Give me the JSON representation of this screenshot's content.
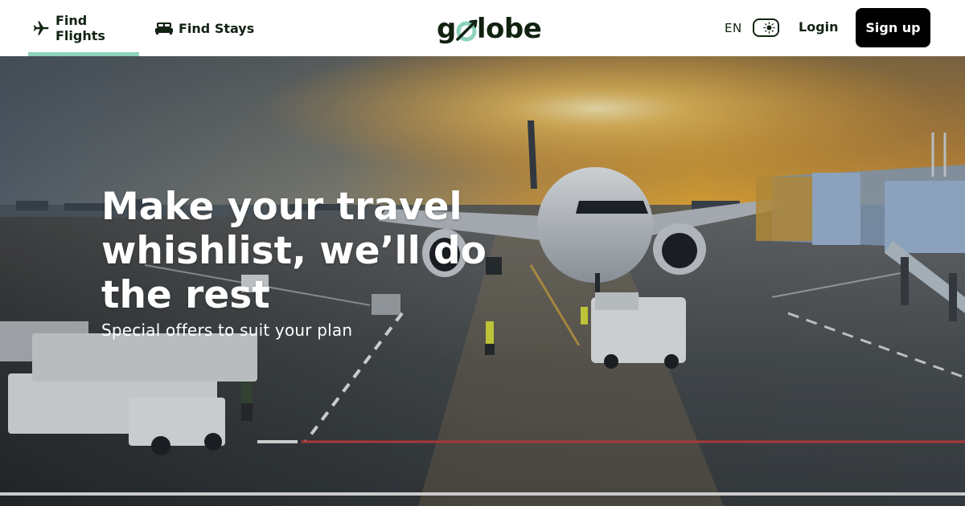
{
  "header": {
    "tabs": [
      {
        "label": "Find Flights",
        "icon": "airplane-icon",
        "active": true
      },
      {
        "label": "Find Stays",
        "icon": "bed-icon",
        "active": false
      }
    ],
    "logo": {
      "text_left": "g",
      "text_right": "lobe",
      "brand": "golobe"
    },
    "language": "EN",
    "theme_toggle_icon": "sun-icon",
    "login_label": "Login",
    "signup_label": "Sign up"
  },
  "hero": {
    "title": "Make your travel whishlist, we’ll do the rest",
    "subtitle": "Special offers to suit your plan"
  },
  "colors": {
    "accent": "#8dd3bb",
    "text_dark": "#112211",
    "button_bg": "#000000",
    "button_text": "#ffffff"
  }
}
